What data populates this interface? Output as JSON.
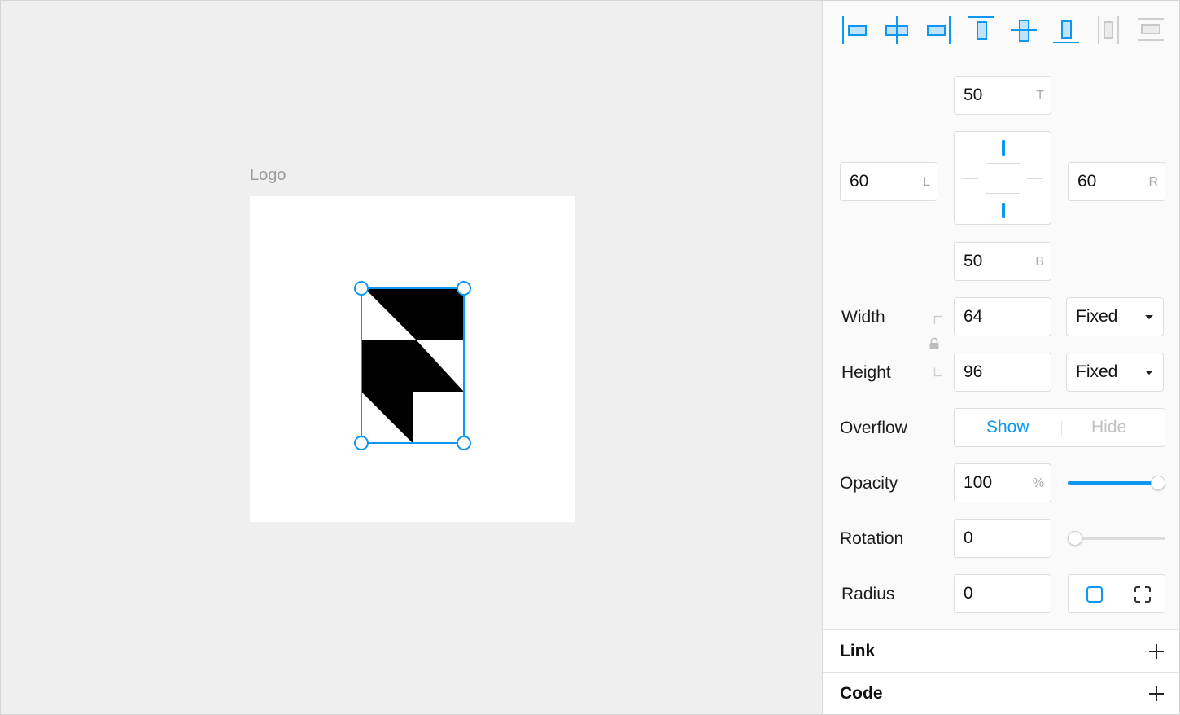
{
  "canvas": {
    "frame_label": "Logo"
  },
  "align_toolbar": {
    "buttons": [
      {
        "icon": "align-left-icon"
      },
      {
        "icon": "align-center-horizontal-icon"
      },
      {
        "icon": "align-right-icon"
      },
      {
        "icon": "align-top-icon"
      },
      {
        "icon": "align-middle-vertical-icon"
      },
      {
        "icon": "align-bottom-icon"
      },
      {
        "icon": "distribute-horizontal-icon"
      },
      {
        "icon": "distribute-vertical-icon"
      }
    ]
  },
  "constraints": {
    "top": {
      "value": "50",
      "suffix": "T"
    },
    "left": {
      "value": "60",
      "suffix": "L"
    },
    "right": {
      "value": "60",
      "suffix": "R"
    },
    "bottom": {
      "value": "50",
      "suffix": "B"
    }
  },
  "size": {
    "width_label": "Width",
    "width_value": "64",
    "width_mode": "Fixed",
    "height_label": "Height",
    "height_value": "96",
    "height_mode": "Fixed"
  },
  "overflow": {
    "label": "Overflow",
    "show": "Show",
    "hide": "Hide",
    "selected": "Show"
  },
  "opacity": {
    "label": "Opacity",
    "value": "100",
    "suffix": "%",
    "slider_fraction": 1.0
  },
  "rotation": {
    "label": "Rotation",
    "value": "0",
    "slider_fraction": 0.0
  },
  "radius": {
    "label": "Radius",
    "value": "0"
  },
  "sections": {
    "link": "Link",
    "code": "Code"
  },
  "colors": {
    "accent": "#0e97f1",
    "canvas_bg": "#efefef",
    "panel_bg": "#fafafa"
  }
}
